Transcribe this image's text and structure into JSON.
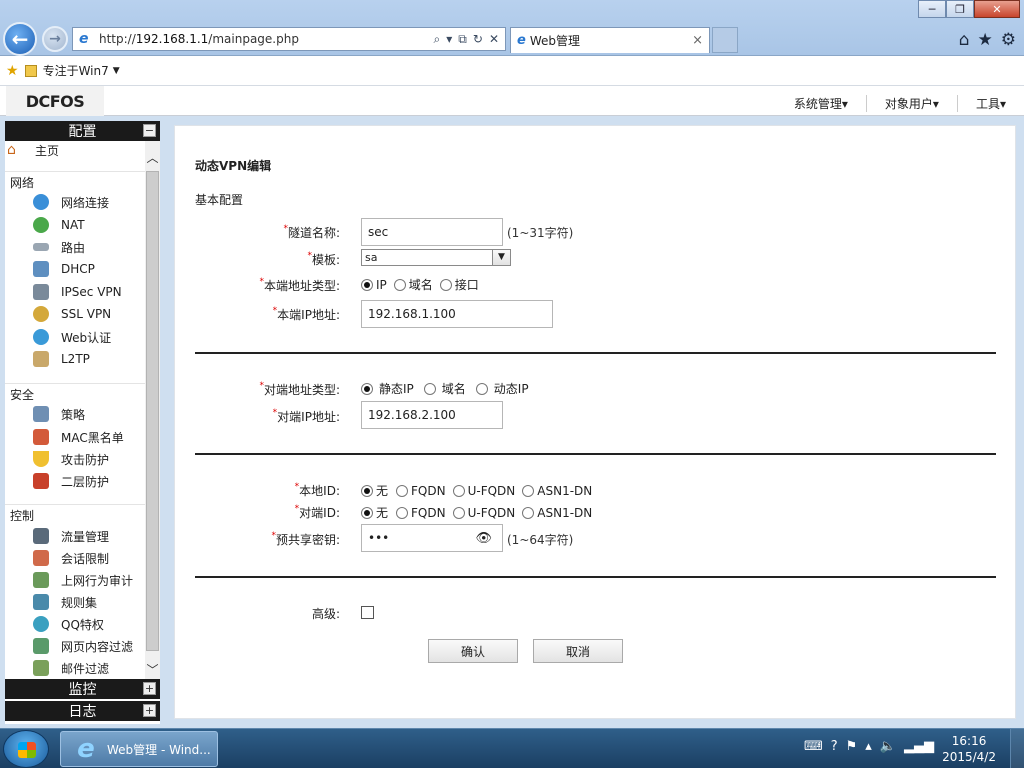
{
  "browser": {
    "url_prefix": "http://",
    "url_host": "192.168.1.1",
    "url_path": "/mainpage.php",
    "tab_title": "Web管理",
    "tab_close": "×",
    "window_minimize": "─",
    "window_maximize": "❐",
    "window_close": "✕",
    "favorite_label": "专注于Win7"
  },
  "app": {
    "logo": "DCFOS",
    "top_menu": [
      {
        "label": "系统管理"
      },
      {
        "label": "对象用户"
      },
      {
        "label": "工具"
      }
    ]
  },
  "sidebar": {
    "header": "配置",
    "header_toggle": "−",
    "home": "主页",
    "groups": [
      {
        "label": "网络",
        "items": [
          "网络连接",
          "NAT",
          "路由",
          "DHCP",
          "IPSec VPN",
          "SSL VPN",
          "Web认证",
          "L2TP"
        ]
      },
      {
        "label": "安全",
        "items": [
          "策略",
          "MAC黑名单",
          "攻击防护",
          "二层防护"
        ]
      },
      {
        "label": "控制",
        "items": [
          "流量管理",
          "会话限制",
          "上网行为审计",
          "规则集",
          "QQ特权",
          "网页内容过滤",
          "邮件过滤"
        ]
      }
    ],
    "footer": [
      {
        "label": "监控",
        "toggle": "+"
      },
      {
        "label": "日志",
        "toggle": "+"
      }
    ]
  },
  "form": {
    "page_title": "动态VPN编辑",
    "section_basic": "基本配置",
    "required_mark": "*",
    "tunnel_name": {
      "label": "隧道名称:",
      "value": "sec",
      "hint": "(1~31字符)"
    },
    "template": {
      "label": "模板:",
      "value": "sa"
    },
    "local_addr_type": {
      "label": "本端地址类型:",
      "options": [
        "IP",
        "域名",
        "接口"
      ],
      "selected": "IP"
    },
    "local_ip": {
      "label": "本端IP地址:",
      "value": "192.168.1.100"
    },
    "peer_addr_type": {
      "label": "对端地址类型:",
      "options": [
        "静态IP",
        "域名",
        "动态IP"
      ],
      "selected": "静态IP"
    },
    "peer_ip": {
      "label": "对端IP地址:",
      "value": "192.168.2.100"
    },
    "local_id": {
      "label": "本地ID:",
      "options": [
        "无",
        "FQDN",
        "U-FQDN",
        "ASN1-DN"
      ],
      "selected": "无"
    },
    "peer_id": {
      "label": "对端ID:",
      "options": [
        "无",
        "FQDN",
        "U-FQDN",
        "ASN1-DN"
      ],
      "selected": "无"
    },
    "psk": {
      "label": "预共享密钥:",
      "value": "•••",
      "hint": "(1~64字符)"
    },
    "advanced": {
      "label": "高级:",
      "checked": false
    },
    "confirm_button": "确认",
    "cancel_button": "取消"
  },
  "taskbar": {
    "task_label": "Web管理 - Wind...",
    "time": "16:16",
    "date": "2015/4/2"
  }
}
